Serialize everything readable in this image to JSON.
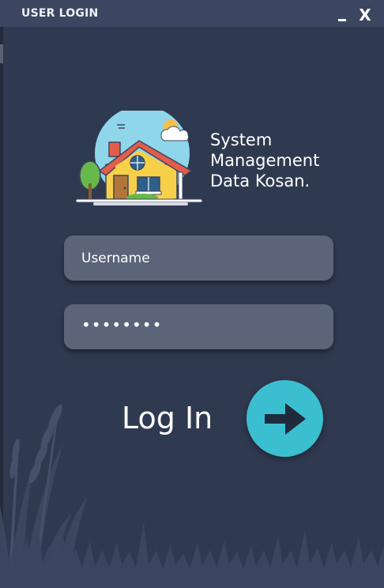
{
  "window": {
    "title": "USER LOGIN",
    "minimize_label": "_",
    "close_label": "X"
  },
  "branding": {
    "logo_icon": "house-icon",
    "name_lines": [
      "System",
      "Management",
      "Data Kosan."
    ]
  },
  "form": {
    "username_placeholder": "Username",
    "password_value": "••••••••",
    "login_label": "Log In",
    "login_icon": "arrow-right-icon"
  },
  "colors": {
    "background": "#2f3950",
    "titlebar": "#3d4660",
    "field": "#5b6478",
    "accent": "#3bbfd0"
  }
}
